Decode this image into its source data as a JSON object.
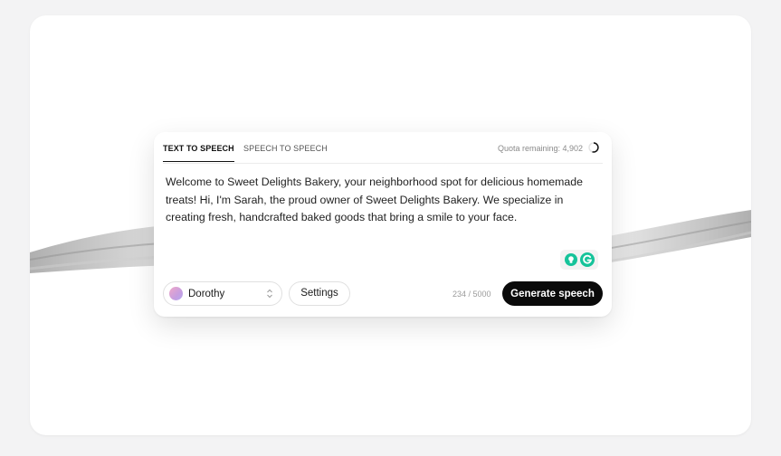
{
  "tabs": {
    "text_to_speech": "TEXT TO SPEECH",
    "speech_to_speech": "SPEECH TO SPEECH",
    "active": "text_to_speech"
  },
  "quota": {
    "label": "Quota remaining: 4,902"
  },
  "editor": {
    "text": "Welcome to Sweet Delights Bakery, your neighborhood spot for delicious homemade treats! Hi, I'm Sarah, the proud owner of Sweet Delights Bakery. We specialize in creating fresh, handcrafted baked goods that bring a smile to your face."
  },
  "extensions": {
    "icons": [
      "lightbulb-icon",
      "grammarly-icon"
    ],
    "grammarly_color": "#15c39a"
  },
  "voice": {
    "selected": "Dorothy"
  },
  "buttons": {
    "settings": "Settings",
    "generate": "Generate speech"
  },
  "char_count": "234 / 5000"
}
